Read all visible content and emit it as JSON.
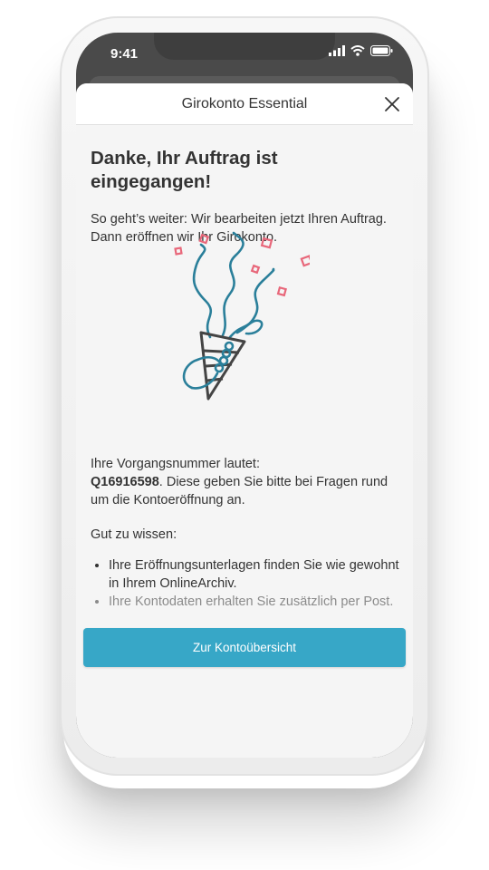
{
  "status_bar": {
    "time": "9:41"
  },
  "sheet": {
    "title": "Girokonto Essential"
  },
  "content": {
    "headline": "Danke, Ihr Auftrag ist eingegangen!",
    "intro": "So geht’s weiter: Wir bearbeiten jetzt Ihren Auftrag. Dann eröffnen wir Ihr Girokonto.",
    "reference_label": "Ihre Vorgangsnummer lautet:",
    "reference_number": "Q16916598",
    "reference_note": ". Diese geben Sie bitte bei Fragen rund um die Kontoeröffnung an.",
    "good_to_know_label": "Gut zu wissen:",
    "bullets": [
      "Ihre Eröffnungsunterlagen finden Sie wie gewohnt in Ihrem OnlineArchiv.",
      "Ihre Kontodaten erhalten Sie zusätzlich per Post."
    ]
  },
  "cta": {
    "label": "Zur Kontoübersicht"
  },
  "colors": {
    "accent": "#37a7c7",
    "illustration_stroke": "#2a7f9a",
    "confetti": "#e8677a",
    "cone": "#444444"
  },
  "icons": [
    "signal-icon",
    "wifi-icon",
    "battery-icon",
    "close-icon",
    "party-popper-illustration"
  ]
}
